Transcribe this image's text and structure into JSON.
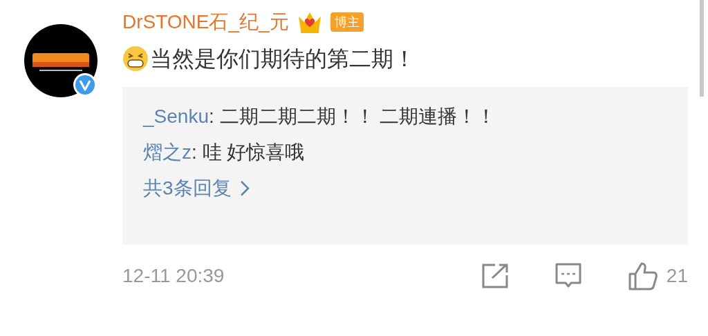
{
  "author": {
    "name": "DrSTONE石_纪_元",
    "verified": true,
    "badge": "博主"
  },
  "comment": {
    "text": "当然是你们期待的第二期！"
  },
  "replies": [
    {
      "user": "_Senku",
      "text": ": 二期二期二期！！ 二期連播！！"
    },
    {
      "user": "熠之z",
      "text": ": 哇 好惊喜哦"
    }
  ],
  "more_replies": "共3条回复",
  "footer": {
    "time": "12-11 20:39",
    "likes": "21"
  }
}
